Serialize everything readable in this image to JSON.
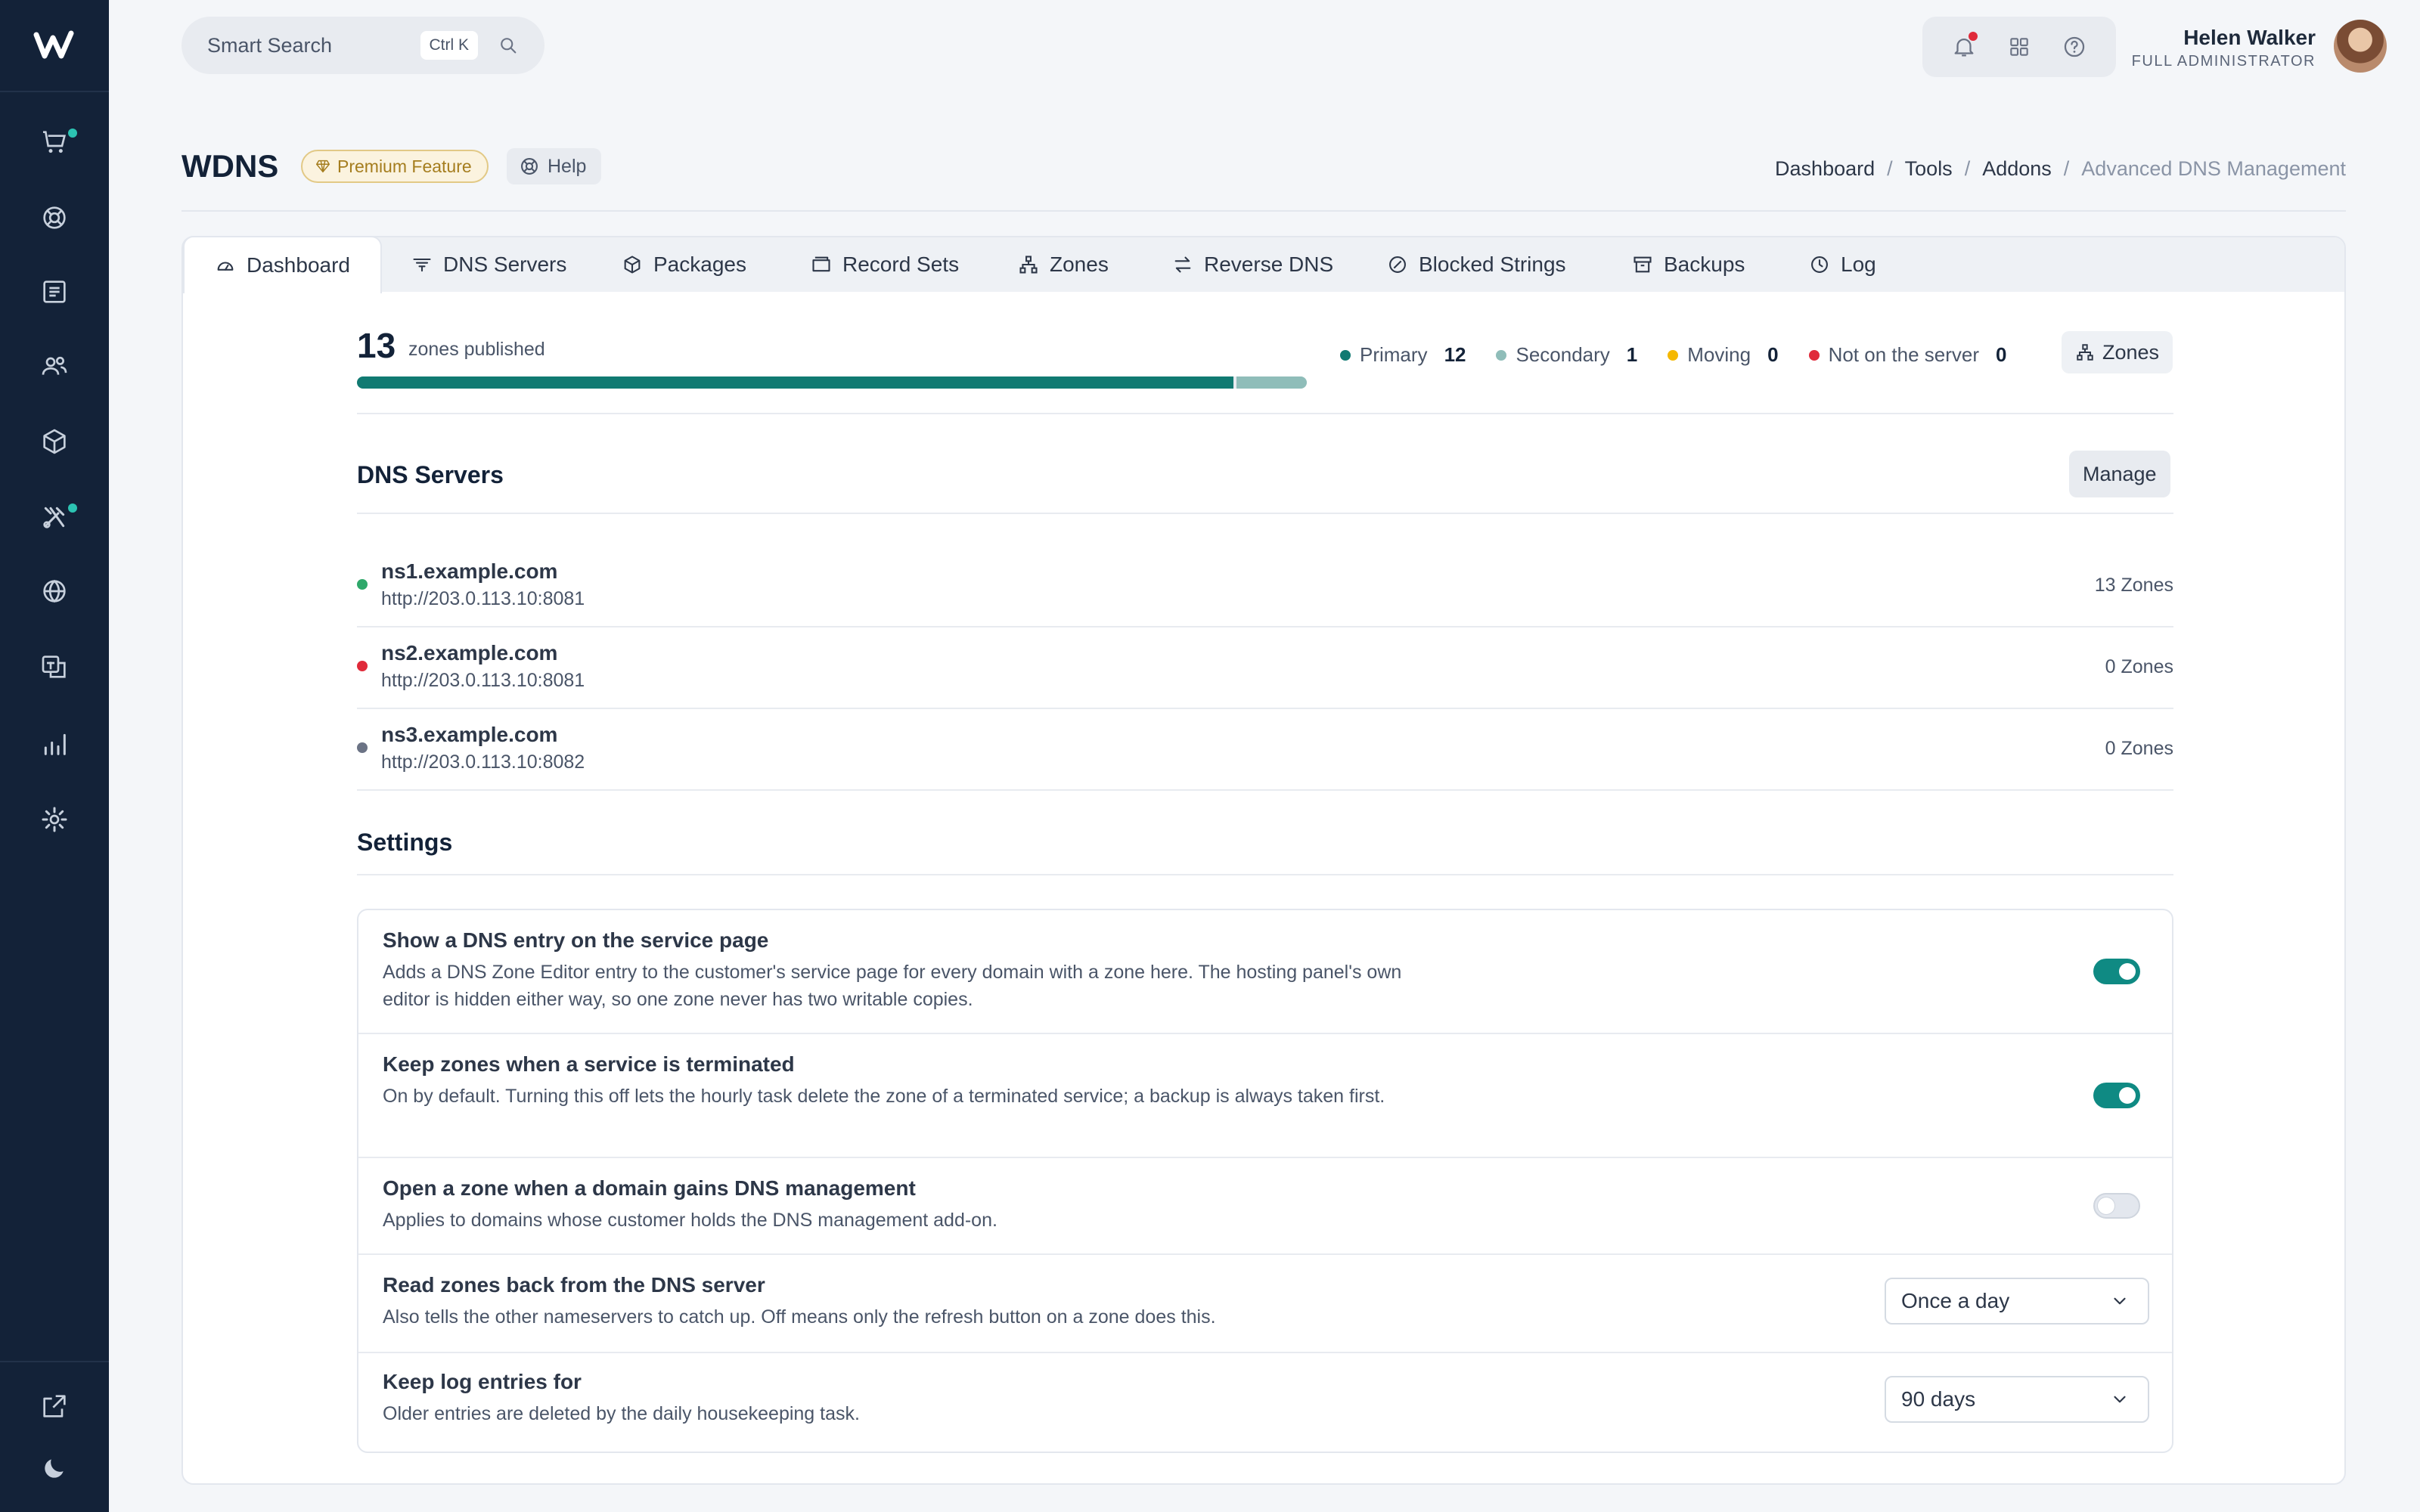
{
  "search": {
    "label": "Smart Search",
    "shortcut": "Ctrl K"
  },
  "user": {
    "name": "Helen Walker",
    "role": "FULL ADMINISTRATOR"
  },
  "page": {
    "title": "WDNS",
    "premium": "Premium Feature",
    "help": "Help"
  },
  "breadcrumb": [
    "Dashboard",
    "Tools",
    "Addons",
    "Advanced DNS Management"
  ],
  "tabs": [
    "Dashboard",
    "DNS Servers",
    "Packages",
    "Record Sets",
    "Zones",
    "Reverse DNS",
    "Blocked Strings",
    "Backups",
    "Log"
  ],
  "summary": {
    "count": "13",
    "label": "zones published",
    "primary_label": "Primary",
    "primary_value": "12",
    "secondary_label": "Secondary",
    "secondary_value": "1",
    "moving_label": "Moving",
    "moving_value": "0",
    "notonserver_label": "Not on the server",
    "notonserver_value": "0",
    "zones_button": "Zones",
    "progress_primary_fraction": 0.923,
    "progress_secondary_fraction": 0.077
  },
  "dns_servers": {
    "title": "DNS Servers",
    "manage": "Manage",
    "items": [
      {
        "host": "ns1.example.com",
        "url": "http://203.0.113.10:8081",
        "zones": "13 Zones",
        "status_color": "#2fa86a"
      },
      {
        "host": "ns2.example.com",
        "url": "http://203.0.113.10:8081",
        "zones": "0 Zones",
        "status_color": "#e02a3a"
      },
      {
        "host": "ns3.example.com",
        "url": "http://203.0.113.10:8082",
        "zones": "0 Zones",
        "status_color": "#6b7385"
      }
    ]
  },
  "settings": {
    "title": "Settings",
    "items": [
      {
        "title": "Show a DNS entry on the service page",
        "desc": "Adds a DNS Zone Editor entry to the customer's service page for every domain with a zone here. The hosting panel's own editor is hidden either way, so one zone never has two writable copies.",
        "enabled": true
      },
      {
        "title": "Keep zones when a service is terminated",
        "desc": "On by default. Turning this off lets the hourly task delete the zone of a terminated service; a backup is always taken first.",
        "enabled": true
      },
      {
        "title": "Open a zone when a domain gains DNS management",
        "desc": "Applies to domains whose customer holds the DNS management add-on.",
        "enabled": false
      },
      {
        "title": "Read zones back from the DNS server",
        "desc": "Also tells the other nameservers to catch up. Off means only the refresh button on a zone does this.",
        "value": "Once a day"
      },
      {
        "title": "Keep log entries for",
        "desc": "Older entries are deleted by the daily housekeeping task.",
        "value": "90 days"
      }
    ]
  },
  "colors": {
    "sidebar": "#132238",
    "accent": "#0f8a83",
    "primary": "#117a72",
    "secondary": "#8fbdb9",
    "moving": "#f5b800",
    "danger": "#e02a3a"
  }
}
